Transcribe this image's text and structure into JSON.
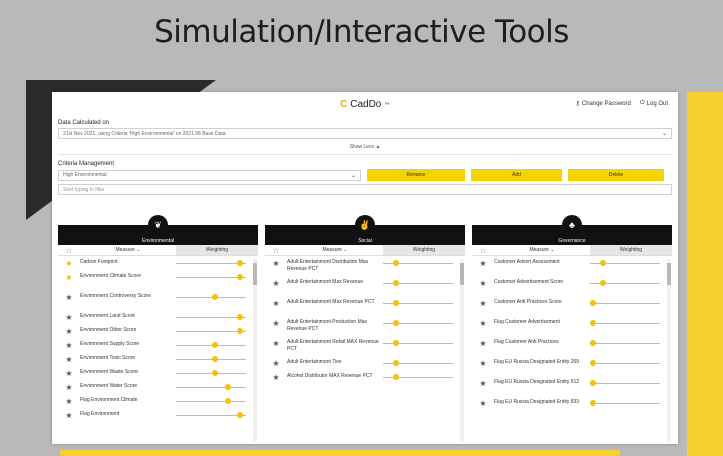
{
  "slide": {
    "title": "Simulation/Interactive Tools"
  },
  "app": {
    "logo_text": "CadDo",
    "logo_mark": "™",
    "change_password": "Change Password",
    "log_out": "Log Out"
  },
  "data_calc": {
    "label": "Data Calculated on",
    "value": "21st Nov 2021, using Criteria 'High Environmental' on 2021 08 Base Data"
  },
  "show_less": "Show Less ▲",
  "criteria": {
    "label": "Criteria Management",
    "selected": "High Environmental",
    "rename": "Rename",
    "add": "Add",
    "delete": "Delete",
    "filter_placeholder": "Start typing to filter"
  },
  "columns": {
    "measure": "Measure ⌄",
    "weighting": "Weighting"
  },
  "panels": [
    {
      "title": "Environmental",
      "icon": "leaf-icon",
      "rows": [
        {
          "name": "Carbon Footprint",
          "fav": true,
          "weight": 0.92
        },
        {
          "name": "Environment Climate Score",
          "fav": true,
          "weight": 0.92
        },
        {
          "name": "Environment Controversy Score",
          "fav": false,
          "weight": 0.55
        },
        {
          "name": "Environment Land Score",
          "fav": false,
          "weight": 0.92
        },
        {
          "name": "Environment Other Score",
          "fav": false,
          "weight": 0.92
        },
        {
          "name": "Environment Supply Score",
          "fav": false,
          "weight": 0.55
        },
        {
          "name": "Environment Toxic Score",
          "fav": false,
          "weight": 0.55
        },
        {
          "name": "Environment Waste Score",
          "fav": false,
          "weight": 0.55
        },
        {
          "name": "Environment Water Score",
          "fav": false,
          "weight": 0.74
        },
        {
          "name": "Flag Environment Climate",
          "fav": false,
          "weight": 0.74
        },
        {
          "name": "Flag Environment",
          "fav": false,
          "weight": 0.92
        }
      ]
    },
    {
      "title": "Social",
      "icon": "handshake-icon",
      "rows": [
        {
          "name": "Adult Entertainment Distribution Max Revenue PCT",
          "fav": false,
          "weight": 0.18
        },
        {
          "name": "Adult Entertainment Max Revenue",
          "fav": false,
          "weight": 0.18
        },
        {
          "name": "Adult Entertainment Max Revenue PCT",
          "fav": false,
          "weight": 0.18
        },
        {
          "name": "Adult Entertainment Production Max Revenue PCT",
          "fav": false,
          "weight": 0.18
        },
        {
          "name": "Adult Entertainment Retail MAX Revenue PCT",
          "fav": false,
          "weight": 0.18
        },
        {
          "name": "Adult Entertainment Ties",
          "fav": false,
          "weight": 0.18
        },
        {
          "name": "Alcohol Distributor MAX Revenue PCT",
          "fav": false,
          "weight": 0.18
        }
      ]
    },
    {
      "title": "Governance",
      "icon": "org-chart-icon",
      "rows": [
        {
          "name": "Customer Advert Assessment",
          "fav": false,
          "weight": 0.18
        },
        {
          "name": "Customer Advertisement Score",
          "fav": false,
          "weight": 0.18
        },
        {
          "name": "Customer Anti Practices Score",
          "fav": false,
          "weight": 0.04
        },
        {
          "name": "Flag Customer Advertisement",
          "fav": false,
          "weight": 0.04
        },
        {
          "name": "Flag Customer Anti Practices",
          "fav": false,
          "weight": 0.04
        },
        {
          "name": "Flag EU Russia Designated Entity 269",
          "fav": false,
          "weight": 0.04
        },
        {
          "name": "Flag EU Russia Designated Entity 512",
          "fav": false,
          "weight": 0.04
        },
        {
          "name": "Flag EU Russia Designated Entity 833",
          "fav": false,
          "weight": 0.04
        }
      ]
    }
  ]
}
